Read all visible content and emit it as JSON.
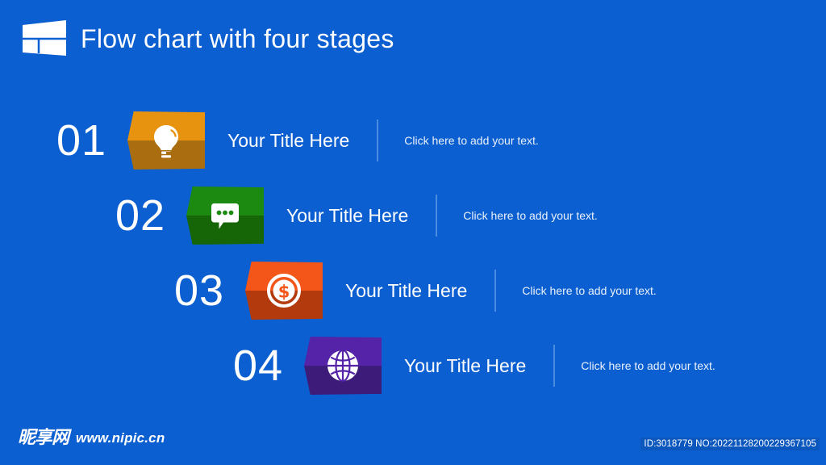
{
  "slide": {
    "background_color": "#0b5fd0",
    "title": "Flow chart with four stages",
    "logo_icon": "windows-logo-icon"
  },
  "stages": [
    {
      "number": "01",
      "title": "Your Title Here",
      "body": "Click here to add your text.",
      "icon": "lightbulb-icon",
      "color_top": "#e8930f",
      "color_bottom": "#aa6e10"
    },
    {
      "number": "02",
      "title": "Your Title Here",
      "body": "Click here to add your text.",
      "icon": "chat-bubble-icon",
      "color_top": "#1c8a10",
      "color_bottom": "#166608"
    },
    {
      "number": "03",
      "title": "Your Title Here",
      "body": "Click here to add your text.",
      "icon": "dollar-coin-icon",
      "color_top": "#f4561a",
      "color_bottom": "#b33a0d"
    },
    {
      "number": "04",
      "title": "Your Title Here",
      "body": "Click here to add your text.",
      "icon": "globe-icon",
      "color_top": "#5423a8",
      "color_bottom": "#3d1b78"
    }
  ],
  "footer": {
    "brand_cn": "昵享网",
    "brand_url": "www.nipic.cn",
    "asset_id": "ID:3018779 NO:20221128200229367105"
  }
}
